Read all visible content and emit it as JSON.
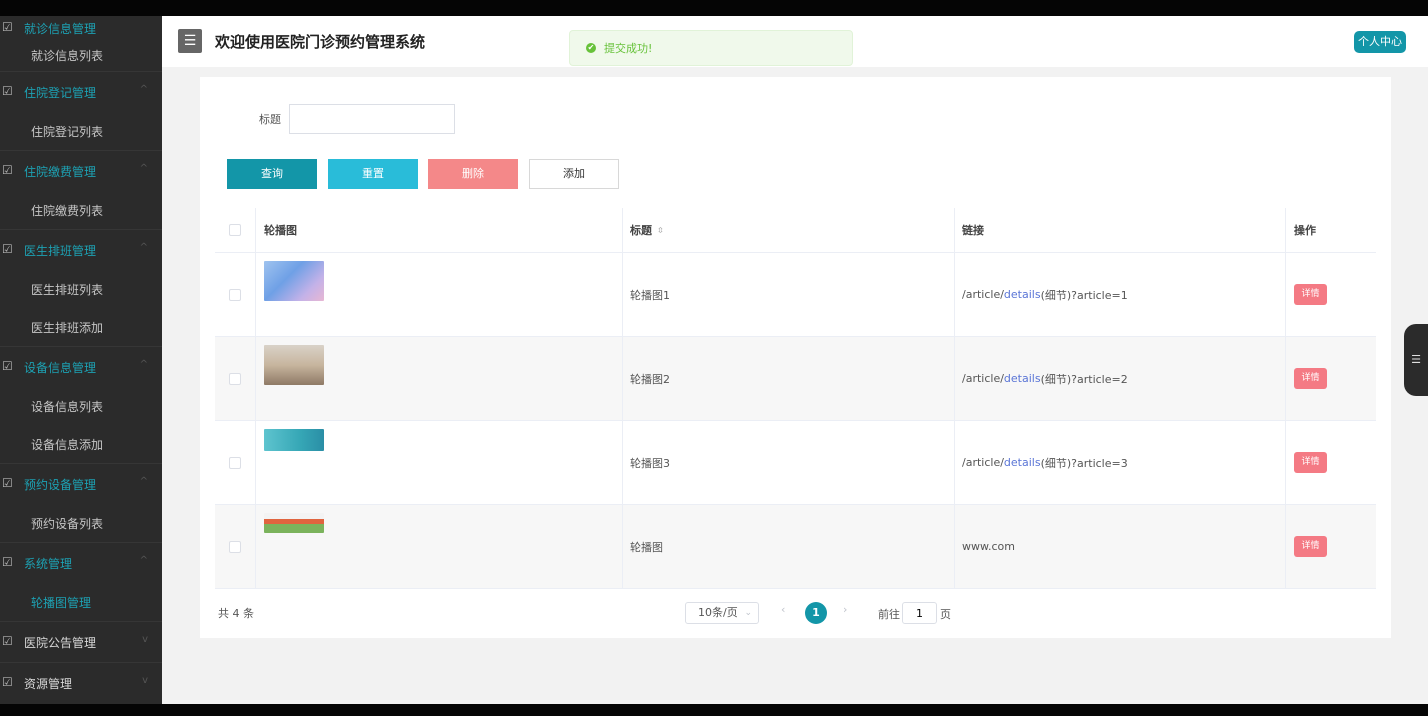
{
  "app": {
    "title": "欢迎使用医院门诊预约管理系统",
    "personal_center": "个人中心"
  },
  "toast": {
    "message": "提交成功!"
  },
  "sidebar": {
    "items": [
      {
        "type": "group",
        "label": "就诊信息管理"
      },
      {
        "type": "sub",
        "label": "就诊信息列表"
      },
      {
        "type": "group",
        "label": "住院登记管理"
      },
      {
        "type": "sub",
        "label": "住院登记列表"
      },
      {
        "type": "group",
        "label": "住院缴费管理"
      },
      {
        "type": "sub",
        "label": "住院缴费列表"
      },
      {
        "type": "group",
        "label": "医生排班管理"
      },
      {
        "type": "sub",
        "label": "医生排班列表"
      },
      {
        "type": "sub",
        "label": "医生排班添加"
      },
      {
        "type": "group",
        "label": "设备信息管理"
      },
      {
        "type": "sub",
        "label": "设备信息列表"
      },
      {
        "type": "sub",
        "label": "设备信息添加"
      },
      {
        "type": "group",
        "label": "预约设备管理"
      },
      {
        "type": "sub",
        "label": "预约设备列表"
      },
      {
        "type": "group",
        "label": "系统管理"
      },
      {
        "type": "sub",
        "label": "轮播图管理"
      },
      {
        "type": "group",
        "label": "医院公告管理"
      },
      {
        "type": "group",
        "label": "资源管理"
      }
    ]
  },
  "search": {
    "label": "标题",
    "value": "",
    "placeholder": ""
  },
  "buttons": {
    "query": "查询",
    "reset": "重置",
    "delete": "删除",
    "add": "添加"
  },
  "table": {
    "headers": {
      "image": "轮播图",
      "title": "标题",
      "link": "链接",
      "action": "操作"
    },
    "rows": [
      {
        "title": "轮播图1",
        "link_pre": "/article/",
        "link_accent": "details",
        "link_post": "(细节)?article=1",
        "action": "详情"
      },
      {
        "title": "轮播图2",
        "link_pre": "/article/",
        "link_accent": "details",
        "link_post": "(细节)?article=2",
        "action": "详情"
      },
      {
        "title": "轮播图3",
        "link_pre": "/article/",
        "link_accent": "details",
        "link_post": "(细节)?article=3",
        "action": "详情"
      },
      {
        "title": "轮播图",
        "link_pre": "www.com",
        "link_accent": "",
        "link_post": "",
        "action": "详情"
      }
    ]
  },
  "pagination": {
    "total": "共 4 条",
    "page_size": "10条/页",
    "current_page": "1",
    "goto_label": "前往",
    "goto_value": "1",
    "goto_unit": "页"
  },
  "icons": {
    "hamburger": "☰",
    "toast": "✔",
    "menu_item": "☑",
    "caret_up": "^",
    "caret_down": "v",
    "sort": "⇳",
    "select_arrow": "⌄",
    "prev": "‹",
    "next": "›",
    "float_tab": "☰"
  },
  "colors": {
    "accent": "#1396a8",
    "reset": "#29bcd9",
    "delete": "#f48889",
    "detail": "#f47a84",
    "success": "#67c23a",
    "sidebar_bg": "#2b2b2b"
  }
}
